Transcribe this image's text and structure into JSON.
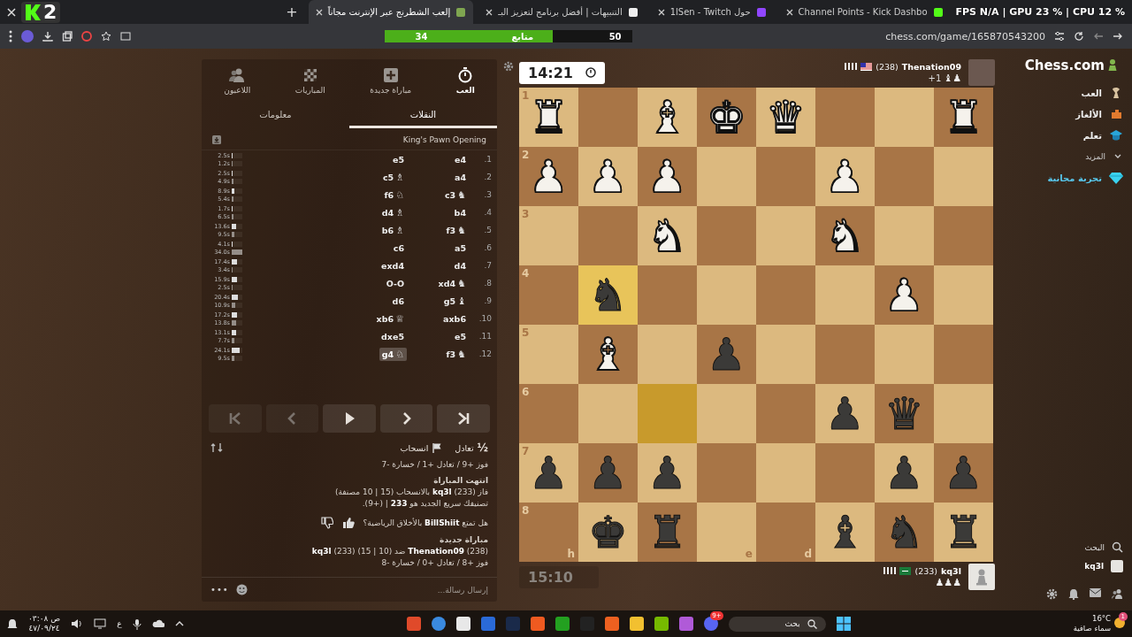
{
  "overlay": {
    "logo_number": "2",
    "stats": "FPS N/A | GPU 23 % | CPU 12 %"
  },
  "browser": {
    "new_tab": "+",
    "tabs": [
      {
        "title": "Channel Points - Kick Dashbo",
        "selected": false
      },
      {
        "title": "حول 1lSen - Twitch",
        "selected": false
      },
      {
        "title": "التنبيهات | أفضل برنامج لتعزيز البـ",
        "selected": false
      },
      {
        "title": "إلعب الشطرنج عبر الإنترنت مجاناً",
        "selected": true
      }
    ],
    "address": "chess.com/game/165870543200"
  },
  "follower_goal": {
    "current": "34",
    "label": "متابع",
    "target": "50",
    "level": 0.68
  },
  "panel": {
    "nav": [
      {
        "kind": "play",
        "label": "العب",
        "selected": true
      },
      {
        "kind": "new",
        "label": "مباراة جديدة",
        "selected": false
      },
      {
        "kind": "games",
        "label": "المباريات",
        "selected": false
      },
      {
        "kind": "players",
        "label": "اللاعبون",
        "selected": false
      }
    ],
    "tabs": [
      {
        "label": "النقلات",
        "selected": true
      },
      {
        "label": "معلومات",
        "selected": false
      }
    ],
    "opening": "King's Pawn Opening",
    "moves": [
      {
        "number": "1.",
        "white": {
          "san": "e4",
          "selected": false
        },
        "black": {
          "san": "e5",
          "selected": false
        },
        "times": [
          {
            "text": "2.5s",
            "level": 0.07
          },
          {
            "text": "1.2s",
            "level": 0.04
          }
        ]
      },
      {
        "number": "2.",
        "white": {
          "san": "a4",
          "selected": false
        },
        "black": {
          "san": "c5",
          "piece": "♗",
          "selected": false
        },
        "times": [
          {
            "text": "2.5s",
            "level": 0.07
          },
          {
            "text": "4.9s",
            "level": 0.14
          }
        ]
      },
      {
        "number": "3.",
        "white": {
          "san": "c3",
          "piece": "♞",
          "selected": false
        },
        "black": {
          "san": "f6",
          "piece": "♘",
          "selected": false
        },
        "times": [
          {
            "text": "8.9s",
            "level": 0.26
          },
          {
            "text": "5.4s",
            "level": 0.16
          }
        ]
      },
      {
        "number": "4.",
        "white": {
          "san": "b4",
          "selected": false
        },
        "black": {
          "san": "d4",
          "piece": "♗",
          "selected": false
        },
        "times": [
          {
            "text": "1.7s",
            "level": 0.05
          },
          {
            "text": "6.5s",
            "level": 0.19
          }
        ]
      },
      {
        "number": "5.",
        "white": {
          "san": "f3",
          "piece": "♞",
          "selected": false
        },
        "black": {
          "san": "b6",
          "piece": "♗",
          "selected": false
        },
        "times": [
          {
            "text": "13.6s",
            "level": 0.4
          },
          {
            "text": "9.5s",
            "level": 0.28
          }
        ]
      },
      {
        "number": "6.",
        "white": {
          "san": "a5",
          "selected": false
        },
        "black": {
          "san": "c6",
          "selected": false
        },
        "times": [
          {
            "text": "4.1s",
            "level": 0.12
          },
          {
            "text": "34.0s",
            "level": 1
          }
        ]
      },
      {
        "number": "7.",
        "white": {
          "san": "d4",
          "selected": false
        },
        "black": {
          "san": "exd4",
          "selected": false
        },
        "times": [
          {
            "text": "17.4s",
            "level": 0.51
          },
          {
            "text": "3.4s",
            "level": 0.1
          }
        ]
      },
      {
        "number": "8.",
        "white": {
          "san": "xd4",
          "piece": "♞",
          "selected": false
        },
        "black": {
          "san": "O-O",
          "selected": false
        },
        "times": [
          {
            "text": "15.9s",
            "level": 0.47
          },
          {
            "text": "2.5s",
            "level": 0.07
          }
        ]
      },
      {
        "number": "9.",
        "white": {
          "san": "g5",
          "piece": "♝",
          "selected": false
        },
        "black": {
          "san": "d6",
          "selected": false
        },
        "times": [
          {
            "text": "20.4s",
            "level": 0.6
          },
          {
            "text": "10.9s",
            "level": 0.32
          }
        ]
      },
      {
        "number": "10.",
        "white": {
          "san": "axb6",
          "selected": false
        },
        "black": {
          "san": "xb6",
          "piece": "♕",
          "selected": false
        },
        "times": [
          {
            "text": "17.2s",
            "level": 0.51
          },
          {
            "text": "13.8s",
            "level": 0.41
          }
        ]
      },
      {
        "number": "11.",
        "white": {
          "san": "e5",
          "selected": false
        },
        "black": {
          "san": "dxe5",
          "selected": false
        },
        "times": [
          {
            "text": "13.1s",
            "level": 0.39
          },
          {
            "text": "7.7s",
            "level": 0.23
          }
        ]
      },
      {
        "number": "12.",
        "white": {
          "san": "f3",
          "piece": "♞",
          "selected": false
        },
        "black": {
          "san": "g4",
          "piece": "♘",
          "selected": true
        },
        "times": [
          {
            "text": "24.1s",
            "level": 0.71
          },
          {
            "text": "9.5s",
            "level": 0.28
          }
        ]
      }
    ],
    "controls": [
      {
        "kind": "first",
        "disabled": true
      },
      {
        "kind": "prev",
        "disabled": true
      },
      {
        "kind": "play",
        "disabled": false
      },
      {
        "kind": "next",
        "disabled": false
      },
      {
        "kind": "last",
        "disabled": false
      }
    ],
    "actions": [
      {
        "kind": "draw",
        "symbol": "½",
        "label": "تعادل"
      },
      {
        "kind": "resign",
        "label": "انسحاب"
      }
    ],
    "messages": [
      {
        "kind": "text",
        "text": "فوز +9 / تعادل +1 / خسارة -7"
      },
      {
        "kind": "heading",
        "text": "انتهت المباراة"
      },
      {
        "kind": "text",
        "text": "فاز (233) **kq3l** بالانسحاب (15 | 10 مصنفة)"
      },
      {
        "kind": "text",
        "text": "تصنيفك سريع الجديد هو **233** | (+9)."
      },
      {
        "kind": "feedback",
        "text": "هل تمتع **BillShiit** بالأخلاق الرياضية؟"
      },
      {
        "kind": "heading",
        "text": "مباراة جديدة"
      },
      {
        "kind": "text",
        "text": "(238) **Thenation09** ضد (10 | 15) (233) **kq3l**"
      },
      {
        "kind": "text",
        "text": "فوز +8 / تعادل +0 / خسارة -8"
      }
    ],
    "chat": {
      "placeholder": "إرسال رسالة...",
      "more": "•••"
    }
  },
  "top_player": {
    "name": "Thenation09",
    "rating": "(238)",
    "captured": "♝♟",
    "advantage": "+1",
    "clock": "14:21",
    "active": true
  },
  "board": {
    "rows": [
      {
        "label": "1",
        "squares": [
          {
            "piece": "♜",
            "kind": "white",
            "highlighted": false
          },
          {
            "highlighted": false
          },
          {
            "highlighted": false
          },
          {
            "piece": "♛",
            "kind": "white",
            "highlighted": false
          },
          {
            "piece": "♚",
            "kind": "white",
            "highlighted": false
          },
          {
            "piece": "♝",
            "kind": "white",
            "highlighted": false
          },
          {
            "highlighted": false
          },
          {
            "piece": "♜",
            "kind": "white",
            "highlighted": false
          }
        ]
      },
      {
        "label": "2",
        "squares": [
          {
            "highlighted": false
          },
          {
            "highlighted": false
          },
          {
            "piece": "♟",
            "kind": "white",
            "highlighted": false
          },
          {
            "highlighted": false
          },
          {
            "highlighted": false
          },
          {
            "piece": "♟",
            "kind": "white",
            "highlighted": false
          },
          {
            "piece": "♟",
            "kind": "white",
            "highlighted": false
          },
          {
            "piece": "♟",
            "kind": "white",
            "highlighted": false
          }
        ]
      },
      {
        "label": "3",
        "squares": [
          {
            "highlighted": false
          },
          {
            "highlighted": false
          },
          {
            "piece": "♞",
            "kind": "white",
            "highlighted": false
          },
          {
            "highlighted": false
          },
          {
            "highlighted": false
          },
          {
            "piece": "♞",
            "kind": "white",
            "highlighted": false
          },
          {
            "highlighted": false
          },
          {
            "highlighted": false
          }
        ]
      },
      {
        "label": "4",
        "squares": [
          {
            "highlighted": false
          },
          {
            "piece": "♟",
            "kind": "white",
            "highlighted": false
          },
          {
            "highlighted": false
          },
          {
            "highlighted": false
          },
          {
            "highlighted": false
          },
          {
            "highlighted": false
          },
          {
            "piece": "♞",
            "kind": "black",
            "highlighted": true
          },
          {
            "highlighted": false
          }
        ]
      },
      {
        "label": "5",
        "squares": [
          {
            "highlighted": false
          },
          {
            "highlighted": false
          },
          {
            "highlighted": false
          },
          {
            "highlighted": false
          },
          {
            "piece": "♟",
            "kind": "black",
            "highlighted": false
          },
          {
            "highlighted": false
          },
          {
            "piece": "♝",
            "kind": "white",
            "highlighted": false
          },
          {
            "highlighted": false
          }
        ]
      },
      {
        "label": "6",
        "squares": [
          {
            "highlighted": false
          },
          {
            "piece": "♛",
            "kind": "black",
            "highlighted": false
          },
          {
            "piece": "♟",
            "kind": "black",
            "highlighted": false
          },
          {
            "highlighted": false
          },
          {
            "highlighted": false
          },
          {
            "highlighted": true
          },
          {
            "highlighted": false
          },
          {
            "highlighted": false
          }
        ]
      },
      {
        "label": "7",
        "squares": [
          {
            "piece": "♟",
            "kind": "black",
            "highlighted": false
          },
          {
            "piece": "♟",
            "kind": "black",
            "highlighted": false
          },
          {
            "highlighted": false
          },
          {
            "highlighted": false
          },
          {
            "highlighted": false
          },
          {
            "piece": "♟",
            "kind": "black",
            "highlighted": false
          },
          {
            "piece": "♟",
            "kind": "black",
            "highlighted": false
          },
          {
            "piece": "♟",
            "kind": "black",
            "highlighted": false
          }
        ]
      },
      {
        "label": "8",
        "squares": [
          {
            "piece": "♜",
            "kind": "black",
            "highlighted": false
          },
          {
            "piece": "♞",
            "kind": "black",
            "highlighted": false
          },
          {
            "piece": "♝",
            "kind": "black",
            "highlighted": false
          },
          {
            "file": "d",
            "highlighted": false
          },
          {
            "file": "e",
            "highlighted": false
          },
          {
            "piece": "♜",
            "kind": "black",
            "highlighted": false
          },
          {
            "piece": "♚",
            "kind": "black",
            "highlighted": false
          },
          {
            "file": "h",
            "highlighted": false
          }
        ]
      }
    ]
  },
  "bottom_player": {
    "name": "kq3l",
    "rating": "(233)",
    "captured": "♟♟♟",
    "clock": "15:10",
    "active": false
  },
  "sidebar": {
    "logo": "Chess.com",
    "nav": [
      {
        "kind": "play",
        "label": "العب"
      },
      {
        "kind": "puzzles",
        "label": "الألغاز"
      },
      {
        "kind": "learn",
        "label": "تعلم"
      },
      {
        "kind": "more",
        "label": "المزيد"
      },
      {
        "kind": "trial",
        "label": "تجربة مجانية"
      }
    ],
    "search": "البحث",
    "user": "kq3l"
  },
  "taskbar": {
    "weather": {
      "temperature": "16°C",
      "condition": "سماء صافية",
      "badge": "1"
    },
    "search": "بحث",
    "discord_badge": "9+",
    "language": "ع",
    "time": "ص ٠٣:٠٨",
    "date": "٤٧/٠٩/٢٤"
  }
}
